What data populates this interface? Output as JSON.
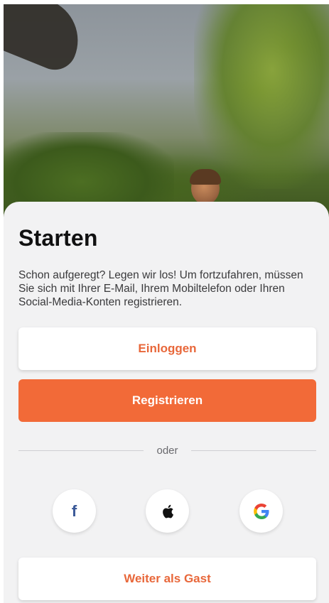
{
  "auth": {
    "title": "Starten",
    "subtitle": "Schon aufgeregt? Legen wir los! Um fortzufahren, müssen Sie sich mit Ihrer E-Mail, Ihrem Mobiltelefon oder Ihren Social-Media-Konten registrieren.",
    "login_label": "Einloggen",
    "register_label": "Registrieren",
    "divider_label": "oder",
    "guest_label": "Weiter als Gast"
  },
  "social": [
    {
      "icon": "facebook-icon",
      "glyph": "f",
      "color": "#3b5998"
    },
    {
      "icon": "apple-icon"
    },
    {
      "icon": "google-icon"
    }
  ],
  "colors": {
    "accent": "#f26a38",
    "accent_text": "#e8673a",
    "sheet_background": "#f2f2f3"
  }
}
